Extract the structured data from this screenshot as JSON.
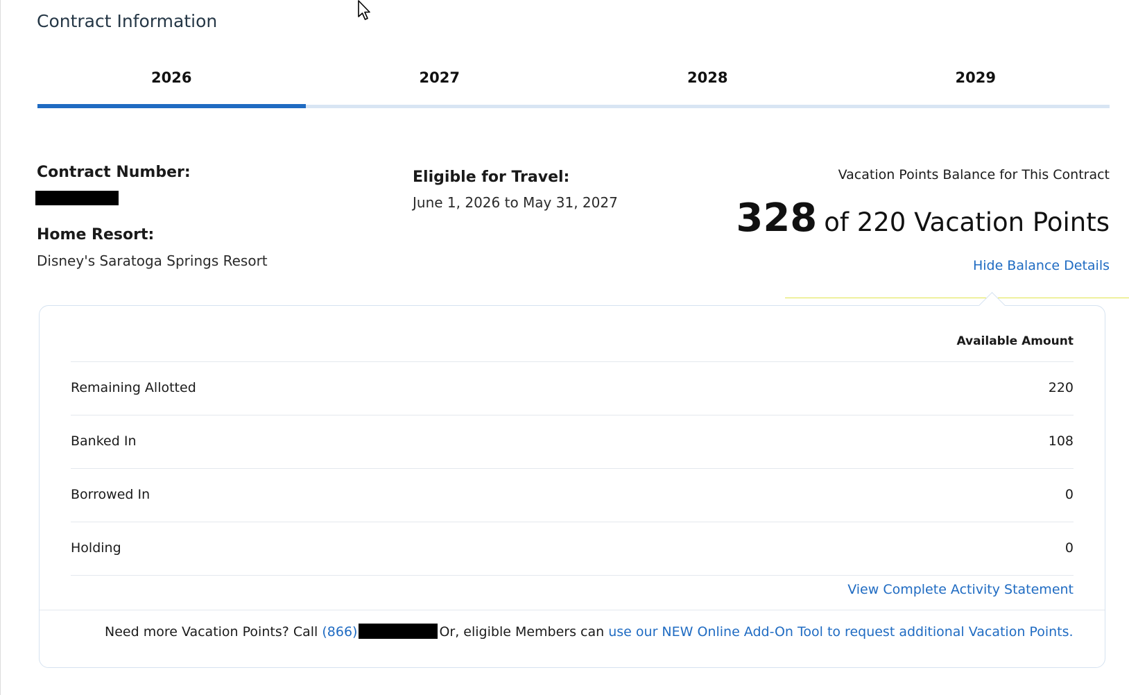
{
  "page": {
    "title": "Contract Information"
  },
  "tabs": [
    {
      "label": "2026",
      "active": true
    },
    {
      "label": "2027",
      "active": false
    },
    {
      "label": "2028",
      "active": false
    },
    {
      "label": "2029",
      "active": false
    }
  ],
  "contract": {
    "number_label": "Contract Number:",
    "home_resort_label": "Home Resort:",
    "home_resort_value": "Disney's Saratoga Springs Resort",
    "travel_label": "Eligible for Travel:",
    "travel_value": "June 1, 2026 to May 31, 2027"
  },
  "balance": {
    "label": "Vacation Points Balance for This Contract",
    "available": "328",
    "of_text": "of 220 Vacation Points",
    "hide_details_label": "Hide Balance Details"
  },
  "details": {
    "column_header": "Available Amount",
    "rows": [
      {
        "label": "Remaining Allotted",
        "value": "220"
      },
      {
        "label": "Banked In",
        "value": "108"
      },
      {
        "label": "Borrowed In",
        "value": "0"
      },
      {
        "label": "Holding",
        "value": "0"
      }
    ],
    "activity_link": "View Complete Activity Statement"
  },
  "footer": {
    "prefix": "Need more Vacation Points? Call",
    "phone_area": "(866)",
    "middle": "Or, eligible Members can",
    "addon_link": "use our NEW Online Add-On Tool to request additional Vacation Points."
  },
  "colors": {
    "accent": "#1f6bc2",
    "tab_track": "#d8e5f3",
    "card_border": "#d5e2f0"
  }
}
